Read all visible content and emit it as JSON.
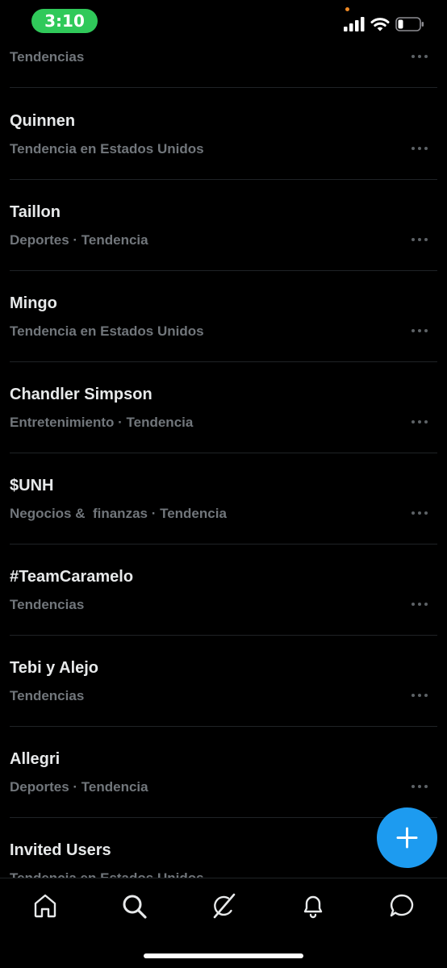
{
  "status_bar": {
    "time": "3:10"
  },
  "trends": [
    {
      "title": "",
      "subtitle": "Tendencias"
    },
    {
      "title": "Quinnen",
      "subtitle": "Tendencia en Estados Unidos"
    },
    {
      "title": "Taillon",
      "subtitle": "Deportes · Tendencia"
    },
    {
      "title": "Mingo",
      "subtitle": "Tendencia en Estados Unidos"
    },
    {
      "title": "Chandler Simpson",
      "subtitle": "Entretenimiento · Tendencia"
    },
    {
      "title": "$UNH",
      "subtitle": "Negocios &  finanzas · Tendencia"
    },
    {
      "title": "#TeamCaramelo",
      "subtitle": "Tendencias"
    },
    {
      "title": "Tebi y Alejo",
      "subtitle": "Tendencias"
    },
    {
      "title": "Allegri",
      "subtitle": "Deportes · Tendencia"
    },
    {
      "title": "Invited Users",
      "subtitle": "Tendencia en Estados Unidos"
    }
  ],
  "fab": {
    "icon": "plus-icon"
  },
  "nav": [
    {
      "name": "home",
      "icon": "home-icon"
    },
    {
      "name": "search",
      "icon": "search-icon"
    },
    {
      "name": "grok",
      "icon": "grok-icon"
    },
    {
      "name": "notifications",
      "icon": "bell-icon"
    },
    {
      "name": "messages",
      "icon": "message-icon"
    }
  ],
  "colors": {
    "background": "#000000",
    "title": "#e7e9ea",
    "subtitle": "#71767b",
    "accent": "#1d9bf0",
    "time_pill": "#30c95a"
  }
}
